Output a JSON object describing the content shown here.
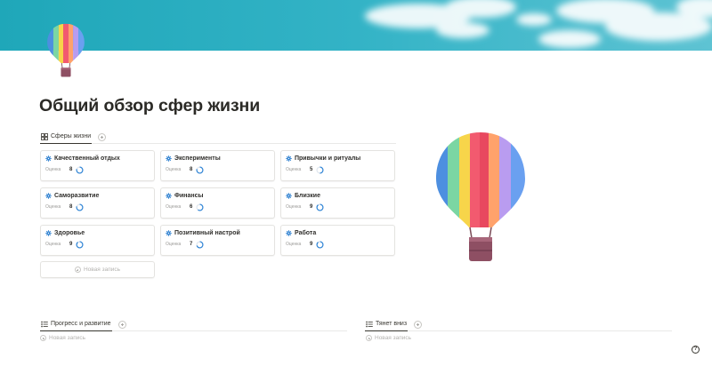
{
  "page": {
    "title": "Общий обзор сфер жизни"
  },
  "icons": {
    "cover": "sky-clouds-cover",
    "page_icon": "hot-air-balloon-icon",
    "area": "gear-icon",
    "rating": "progress-ring-icon",
    "view": "gallery-view-icon",
    "list_view": "list-view-icon",
    "help": "help-icon"
  },
  "colors": {
    "sky": "#3ab4c8",
    "accent_ring": "#2e84d6",
    "text": "#37352f"
  },
  "gallery": {
    "tab_label": "Сферы жизни",
    "new_label": "Новая запись",
    "rating_label": "Оценка",
    "cards": [
      {
        "title": "Качественный отдых",
        "rating": "8",
        "progress": 0.8
      },
      {
        "title": "Эксперименты",
        "rating": "8",
        "progress": 0.8
      },
      {
        "title": "Привычки и ритуалы",
        "rating": "5",
        "progress": 0.5
      },
      {
        "title": "Саморазвитие",
        "rating": "8",
        "progress": 0.8
      },
      {
        "title": "Финансы",
        "rating": "6",
        "progress": 0.6
      },
      {
        "title": "Близкие",
        "rating": "9",
        "progress": 0.9
      },
      {
        "title": "Здоровье",
        "rating": "9",
        "progress": 0.9
      },
      {
        "title": "Позитивный настрой",
        "rating": "7",
        "progress": 0.7
      },
      {
        "title": "Работа",
        "rating": "9",
        "progress": 0.9
      }
    ]
  },
  "progress_db": {
    "tab_label": "Прогресс и развитие",
    "new_label": "Новая запись"
  },
  "pulls_db": {
    "tab_label": "Тянет вниз",
    "new_label": "Новая запись"
  },
  "help_label": "?"
}
